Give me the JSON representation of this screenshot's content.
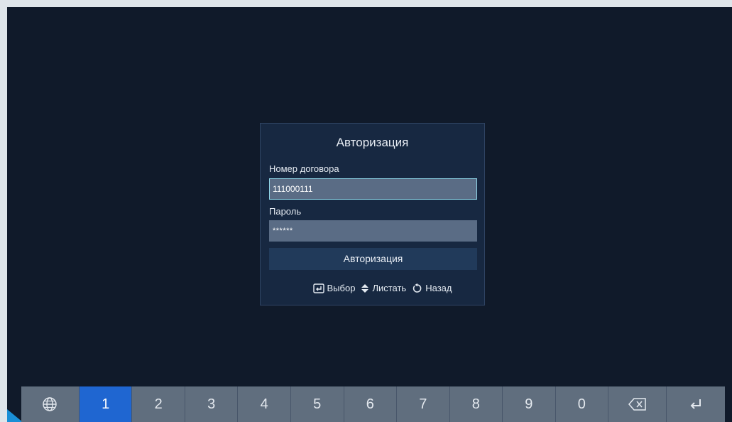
{
  "dialog": {
    "title": "Авторизация",
    "contract_label": "Номер договора",
    "contract_value": "111000111",
    "password_label": "Пароль",
    "password_value": "******",
    "submit_label": "Авторизация",
    "hints": {
      "select": "Выбор",
      "scroll": "Листать",
      "back": "Назад"
    }
  },
  "keyboard": {
    "digits": [
      "1",
      "2",
      "3",
      "4",
      "5",
      "6",
      "7",
      "8",
      "9",
      "0"
    ],
    "active_key": "1",
    "icons": [
      "globe-icon",
      "backspace-icon",
      "enter-icon"
    ]
  },
  "colors": {
    "background": "#101a2a",
    "dialog": "#172841",
    "field": "#5a6c85",
    "focus_border": "#8fd6e8",
    "active_key": "#1f66d1",
    "key": "#606e7e"
  }
}
